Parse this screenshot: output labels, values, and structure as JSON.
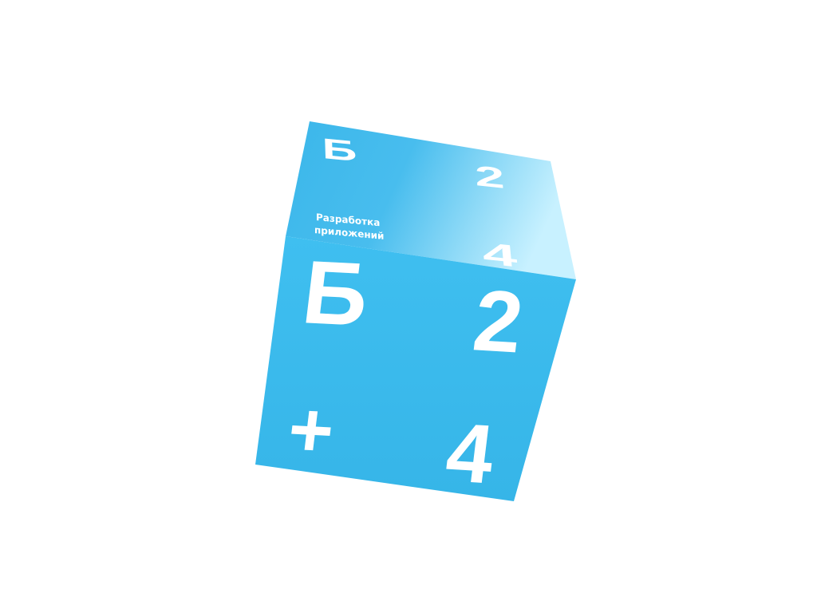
{
  "logo": {
    "top_face": {
      "glyph_tl": "Б",
      "glyph_tr": "2",
      "glyph_br": "4",
      "caption_line1": "Разработка",
      "caption_line2": "приложений"
    },
    "front_face": {
      "glyph_tl": "Б",
      "glyph_tr": "2",
      "glyph_bl": "+",
      "glyph_br": "4"
    }
  },
  "colors": {
    "cube_blue": "#3bbcec",
    "cube_blue_dark": "#35b4e6",
    "highlight": "#c8f1ff",
    "text": "#ffffff"
  }
}
